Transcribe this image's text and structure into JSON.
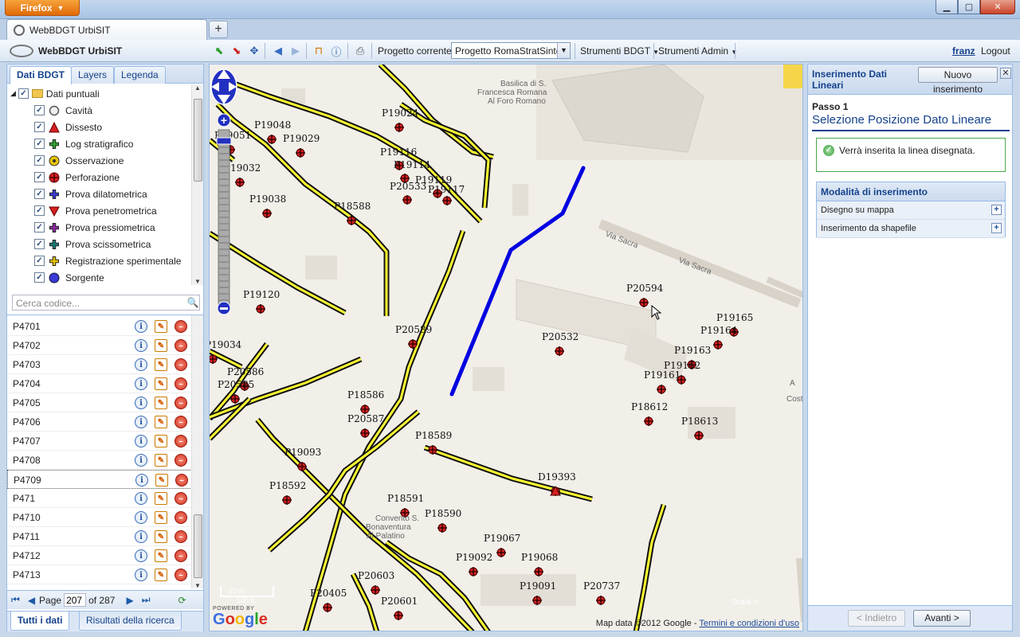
{
  "browser": {
    "app_button": "Firefox",
    "tab_title": "WebBDGT UrbiSIT",
    "new_tab": "+"
  },
  "toolbar": {
    "app_title": "WebBDGT UrbiSIT",
    "project_label": "Progetto corrente:",
    "project_value": "Progetto RomaStratSintes",
    "menu_bdgt": "Strumenti BDGT",
    "menu_admin": "Strumenti Admin",
    "user": "franz",
    "logout": "Logout"
  },
  "left_panel": {
    "tabs": [
      "Dati BDGT",
      "Layers",
      "Legenda"
    ],
    "tree_root": "Dati puntuali",
    "tree_items": [
      {
        "label": "Cavità",
        "icon": "circle-outline-icon",
        "color": "#555555"
      },
      {
        "label": "Dissesto",
        "icon": "triangle-up-icon",
        "color": "#d42020"
      },
      {
        "label": "Log stratigrafico",
        "icon": "cross-green-icon",
        "color": "#2aa52a"
      },
      {
        "label": "Osservazione",
        "icon": "target-yellow-icon",
        "color": "#e8c400"
      },
      {
        "label": "Perforazione",
        "icon": "crosshair-red-icon",
        "color": "#d42020"
      },
      {
        "label": "Prova dilatometrica",
        "icon": "cross-blue-icon",
        "color": "#3a3ad4"
      },
      {
        "label": "Prova penetrometrica",
        "icon": "triangle-down-icon",
        "color": "#d42020"
      },
      {
        "label": "Prova pressiometrica",
        "icon": "cross-purple-icon",
        "color": "#8a2aa0"
      },
      {
        "label": "Prova scissometrica",
        "icon": "cross-teal-icon",
        "color": "#1a7a7a"
      },
      {
        "label": "Registrazione sperimentale",
        "icon": "cross-yellow-icon",
        "color": "#e8c400"
      },
      {
        "label": "Sorgente",
        "icon": "circle-blue-icon",
        "color": "#3a3ad4"
      }
    ],
    "search_placeholder": "Cerca codice...",
    "codes": [
      "P4701",
      "P4702",
      "P4703",
      "P4704",
      "P4705",
      "P4706",
      "P4707",
      "P4708",
      "P4709",
      "P471",
      "P4710",
      "P4711",
      "P4712",
      "P4713"
    ],
    "selected_code": "P4709",
    "pager": {
      "page_label": "Page",
      "page": "207",
      "of_label": "of 287"
    },
    "bottom_tabs": [
      "Tutti i dati",
      "Risultati della ricerca"
    ]
  },
  "map": {
    "labels": {
      "basilica": "Basilica di S.\nFrancesca Romana\nAl Foro Romano",
      "via_sacra": "Via Sacra",
      "convento": "Convento S.\nBonaventura\nAl Palatino",
      "cost": "Cost",
      "scale_m": "20 m",
      "scale_ft": "100 ft"
    },
    "points": [
      {
        "code": "P19024",
        "kind": "perforazione"
      },
      {
        "code": "P19048",
        "kind": "perforazione"
      },
      {
        "code": "P19029",
        "kind": "perforazione"
      },
      {
        "code": "P19051",
        "kind": "perforazione"
      },
      {
        "code": "P19032",
        "kind": "perforazione"
      },
      {
        "code": "P19038",
        "kind": "perforazione"
      },
      {
        "code": "P19116",
        "kind": "perforazione"
      },
      {
        "code": "P19114",
        "kind": "perforazione"
      },
      {
        "code": "P19119",
        "kind": "perforazione"
      },
      {
        "code": "P20533",
        "kind": "perforazione"
      },
      {
        "code": "P19117",
        "kind": "perforazione"
      },
      {
        "code": "P18588",
        "kind": "perforazione"
      },
      {
        "code": "P19120",
        "kind": "perforazione"
      },
      {
        "code": "P20589",
        "kind": "perforazione"
      },
      {
        "code": "P20532",
        "kind": "perforazione"
      },
      {
        "code": "P20594",
        "kind": "perforazione"
      },
      {
        "code": "P19165",
        "kind": "perforazione"
      },
      {
        "code": "P19164",
        "kind": "perforazione"
      },
      {
        "code": "P19163",
        "kind": "perforazione"
      },
      {
        "code": "P19162",
        "kind": "perforazione"
      },
      {
        "code": "P19161",
        "kind": "perforazione"
      },
      {
        "code": "P18612",
        "kind": "perforazione"
      },
      {
        "code": "P18613",
        "kind": "perforazione"
      },
      {
        "code": "P20586",
        "kind": "perforazione"
      },
      {
        "code": "P20585",
        "kind": "perforazione"
      },
      {
        "code": "P18586",
        "kind": "perforazione"
      },
      {
        "code": "P20587",
        "kind": "perforazione"
      },
      {
        "code": "P18589",
        "kind": "perforazione"
      },
      {
        "code": "D19393",
        "kind": "dissesto"
      },
      {
        "code": "P19093",
        "kind": "perforazione"
      },
      {
        "code": "P18592",
        "kind": "perforazione"
      },
      {
        "code": "P18591",
        "kind": "perforazione"
      },
      {
        "code": "P18590",
        "kind": "perforazione"
      },
      {
        "code": "P19067",
        "kind": "perforazione"
      },
      {
        "code": "P19092",
        "kind": "perforazione"
      },
      {
        "code": "P19068",
        "kind": "perforazione"
      },
      {
        "code": "P19091",
        "kind": "perforazione"
      },
      {
        "code": "P20603",
        "kind": "perforazione"
      },
      {
        "code": "P20405",
        "kind": "perforazione"
      },
      {
        "code": "P20601",
        "kind": "perforazione"
      },
      {
        "code": "P20737",
        "kind": "perforazione"
      },
      {
        "code": "P19034",
        "kind": "perforazione"
      }
    ],
    "attribution_text": "Map data ©2012 Google - ",
    "attribution_link": "Termini e condizioni d'uso",
    "powered_by": "POWERED BY",
    "google": "Google",
    "scale_text": "Scala ="
  },
  "right_panel": {
    "title": "Inserimento Dati Lineari",
    "new_button": "Nuovo inserimento",
    "step": "Passo 1",
    "step_title": "Selezione Posizione Dato Lineare",
    "message": "Verrà inserita la linea disegnata.",
    "modes_title": "Modalità di inserimento",
    "modes": [
      "Disegno su mappa",
      "Inserimento da shapefile"
    ],
    "prev_button": "< Indietro",
    "next_button": "Avanti >"
  },
  "colors": {
    "accent": "#15428b",
    "drawn_line": "#0000e0",
    "road": "#ffff33",
    "point": "#d42020"
  }
}
